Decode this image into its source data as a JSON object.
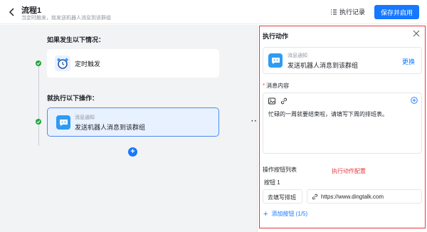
{
  "header": {
    "title": "流程1",
    "subtitle": "当定时触发，就发送机器人消息到该群组",
    "history_label": "执行记录",
    "save_label": "保存并启用"
  },
  "canvas": {
    "condition_label": "如果发生以下情况：",
    "trigger": {
      "label": "定时触发",
      "icon": "alarm-clock-icon"
    },
    "then_label": "就执行以下操作：",
    "action": {
      "small": "消息通知",
      "main": "发送机器人消息到该群组",
      "icon": "chat-message-icon"
    }
  },
  "panel": {
    "title": "执行动作",
    "action_small": "消息通知",
    "action_main": "发送机器人消息到该群组",
    "change_label": "更换",
    "content_label": "消息内容",
    "message_text": "忙碌的一周就要结束啦，请填写下周的排班表。",
    "button_list_label": "操作按钮列表",
    "annotation": "执行动作配置",
    "button_item_label": "按钮 1",
    "button_name_value": "去填写排班",
    "button_url_value": "https://www.dingtalk.com",
    "add_button_label": "添加按钮 (1/5)"
  },
  "colors": {
    "accent": "#1677ff",
    "success": "#1ea53a",
    "highlight_red": "#e4393c",
    "message_icon": "#2d9cf4"
  }
}
